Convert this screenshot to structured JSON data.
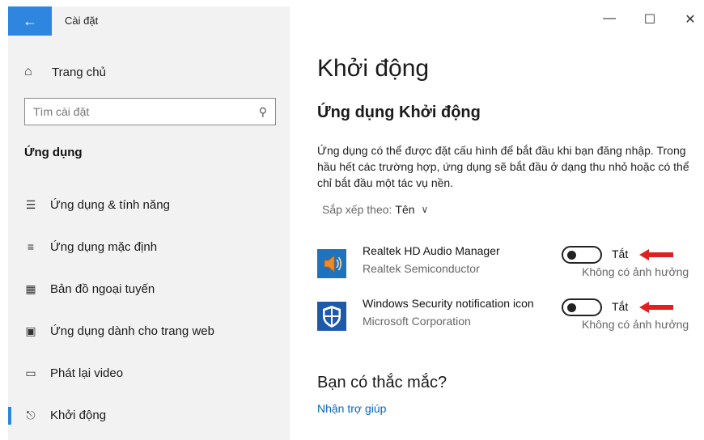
{
  "window": {
    "title": "Cài đặt",
    "controls": [
      "minimize",
      "maximize",
      "close"
    ]
  },
  "sidebar": {
    "home_label": "Trang chủ",
    "search_placeholder": "Tìm cài đặt",
    "section_title": "Ứng dụng",
    "items": [
      {
        "label": "Ứng dụng & tính năng",
        "icon": "apps-features-icon"
      },
      {
        "label": "Ứng dụng mặc định",
        "icon": "default-apps-icon"
      },
      {
        "label": "Bản đồ ngoại tuyến",
        "icon": "offline-maps-icon"
      },
      {
        "label": "Ứng dụng dành cho trang web",
        "icon": "apps-for-websites-icon"
      },
      {
        "label": "Phát lại video",
        "icon": "video-playback-icon"
      },
      {
        "label": "Khởi động",
        "icon": "startup-icon",
        "active": true
      }
    ]
  },
  "main": {
    "title": "Khởi động",
    "subtitle": "Ứng dụng Khởi động",
    "description": "Ứng dụng có thể được đặt cấu hình để bắt đầu khi bạn đăng nhập. Trong hầu hết các trường hợp, ứng dụng sẽ bắt đầu ở dạng thu nhỏ hoặc có thể chỉ bắt đầu một tác vụ nền.",
    "sort_label": "Sắp xếp theo:",
    "sort_value": "Tên",
    "apps": [
      {
        "name": "Realtek HD Audio Manager",
        "publisher": "Realtek Semiconductor",
        "state": "Tắt",
        "enabled": false,
        "impact": "Không có ảnh hưởng",
        "icon": "speaker-icon"
      },
      {
        "name": "Windows Security notification icon",
        "publisher": "Microsoft Corporation",
        "state": "Tắt",
        "enabled": false,
        "impact": "Không có ảnh hưởng",
        "icon": "shield-icon"
      }
    ],
    "question": "Bạn có thắc mắc?",
    "help_link": "Nhận trợ giúp"
  },
  "colors": {
    "accent": "#2e86de",
    "sidebar_bg": "#f2f2f2",
    "link": "#0067c0",
    "annotation_arrow": "#e02020"
  }
}
